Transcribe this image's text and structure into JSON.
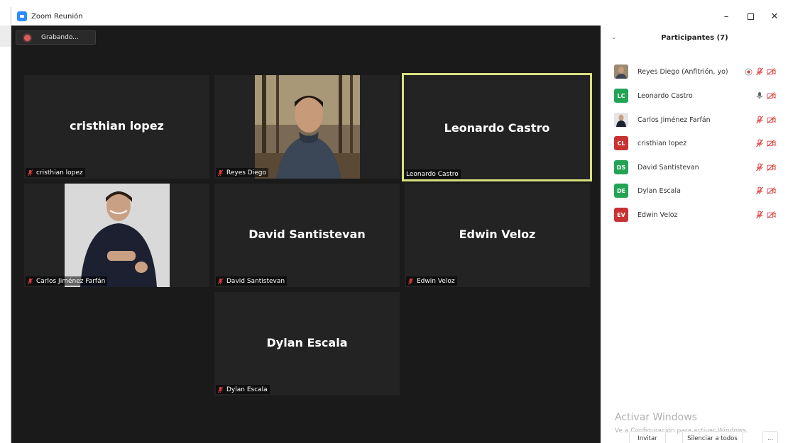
{
  "window": {
    "title": "Zoom Reunión",
    "minimize": "–",
    "close": "✕"
  },
  "recording": {
    "label": "Grabando..."
  },
  "tiles": [
    {
      "id": "cristhian",
      "big_name": "cristhian lopez",
      "label": "cristhian lopez",
      "has_video": false,
      "muted": true
    },
    {
      "id": "reyes",
      "big_name": "",
      "label": "Reyes Diego",
      "has_video": true,
      "muted": true
    },
    {
      "id": "leonardo",
      "big_name": "Leonardo Castro",
      "label": "Leonardo Castro",
      "has_video": false,
      "muted": false,
      "active_speaker": true
    },
    {
      "id": "carlos",
      "big_name": "",
      "label": "Carlos Jiménez Farfán",
      "has_video": true,
      "muted": true
    },
    {
      "id": "david",
      "big_name": "David Santistevan",
      "label": "David Santistevan",
      "has_video": false,
      "muted": true
    },
    {
      "id": "edwin",
      "big_name": "Edwin Veloz",
      "label": "Edwin Veloz",
      "has_video": false,
      "muted": true
    },
    {
      "id": "dylan",
      "big_name": "Dylan Escala",
      "label": "Dylan Escala",
      "has_video": false,
      "muted": true
    }
  ],
  "participants_panel": {
    "title": "Participantes (7)",
    "collapse_icon": "chevron-down-icon",
    "participants": [
      {
        "name": "Reyes Diego (Anfitrión, yo)",
        "initials": "",
        "avatar_color": "#8a7a6a",
        "avatar_type": "photo",
        "recording": true,
        "mic": "muted",
        "video": "off"
      },
      {
        "name": "Leonardo Castro",
        "initials": "LC",
        "avatar_color": "#23a455",
        "avatar_type": "initials",
        "recording": false,
        "mic": "on",
        "video": "off"
      },
      {
        "name": "Carlos Jiménez Farfán",
        "initials": "",
        "avatar_color": "#2b2b2b",
        "avatar_type": "photo",
        "recording": false,
        "mic": "muted",
        "video": "off"
      },
      {
        "name": "cristhian lopez",
        "initials": "CL",
        "avatar_color": "#c83232",
        "avatar_type": "initials",
        "recording": false,
        "mic": "muted",
        "video": "off"
      },
      {
        "name": "David Santistevan",
        "initials": "DS",
        "avatar_color": "#23a455",
        "avatar_type": "initials",
        "recording": false,
        "mic": "muted",
        "video": "off"
      },
      {
        "name": "Dylan Escala",
        "initials": "DE",
        "avatar_color": "#23a455",
        "avatar_type": "initials",
        "recording": false,
        "mic": "muted",
        "video": "off"
      },
      {
        "name": "Edwin Veloz",
        "initials": "EV",
        "avatar_color": "#c83232",
        "avatar_type": "initials",
        "recording": false,
        "mic": "muted",
        "video": "off"
      }
    ],
    "buttons": {
      "invite": "Invitar",
      "mute_all": "Silenciar a todos",
      "more": "..."
    }
  },
  "watermark": {
    "title": "Activar Windows",
    "subtitle": "Ve a Configuración para activar Windows."
  },
  "colors": {
    "muted_red": "#e03c3c",
    "active_border": "#d8e07f",
    "accent_blue": "#2d8cff",
    "tile_bg": "#232323",
    "window_bg": "#1a1a1a"
  }
}
